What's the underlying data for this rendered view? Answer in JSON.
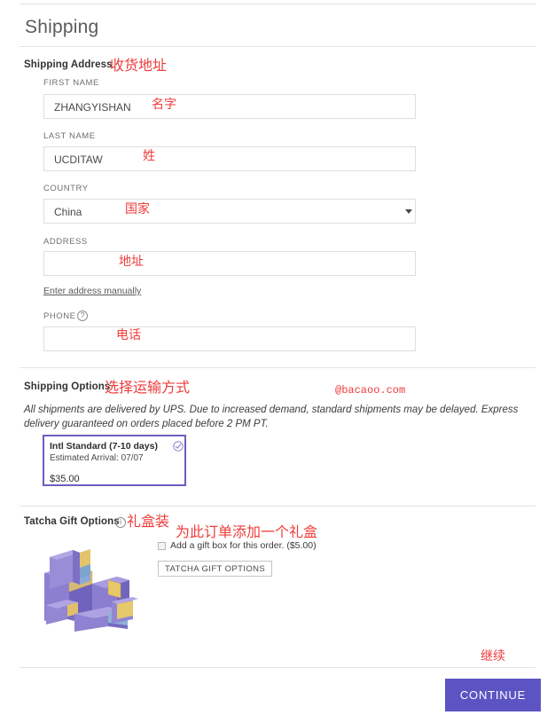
{
  "header": {
    "title": "Shipping"
  },
  "shipping_address": {
    "heading": "Shipping Address",
    "annotation": "收货地址",
    "fields": [
      {
        "label": "FIRST NAME",
        "value": "ZHANGYISHAN",
        "annotation": "名字"
      },
      {
        "label": "LAST NAME",
        "value": "UCDITAW",
        "annotation": "姓"
      },
      {
        "label": "COUNTRY",
        "value": "China",
        "annotation": "国家"
      },
      {
        "label": "ADDRESS",
        "value": "",
        "annotation": "地址"
      },
      {
        "label": "PHONE",
        "value": "",
        "annotation": "电话"
      }
    ],
    "manual_link": "Enter address manually",
    "phone_help_icon": "question-icon"
  },
  "shipping_options": {
    "heading": "Shipping Options",
    "annotation": "选择运输方式",
    "note": "All shipments are delivered by UPS. Due to increased demand, standard shipments may be delayed. Express delivery guaranteed on orders placed before 2 PM PT.",
    "selected_card": {
      "title": "Intl Standard (7-10 days)",
      "eta": "Estimated Arrival: 07/07",
      "price": "$35.00",
      "selected_icon": "check-circle-icon"
    }
  },
  "gift_options": {
    "heading": "Tatcha Gift Options",
    "info_icon": "info-icon",
    "annotation": "礼盒装",
    "annotation_secondary": "为此订单添加一个礼盒",
    "checkbox_label": "Add a gift box for this order. ($5.00)",
    "checkbox_checked": false,
    "button_label": "TATCHA GIFT OPTIONS",
    "image_alt": "gift-boxes-image"
  },
  "footer": {
    "continue_label": "CONTINUE",
    "continue_annotation": "继续"
  },
  "watermark": "@bacaoo.com",
  "colors": {
    "accent_purple": "#5d54c4",
    "card_border_purple": "#6a5fc1",
    "annotation_red": "#ef3b3b",
    "border_gray": "#dedede"
  }
}
